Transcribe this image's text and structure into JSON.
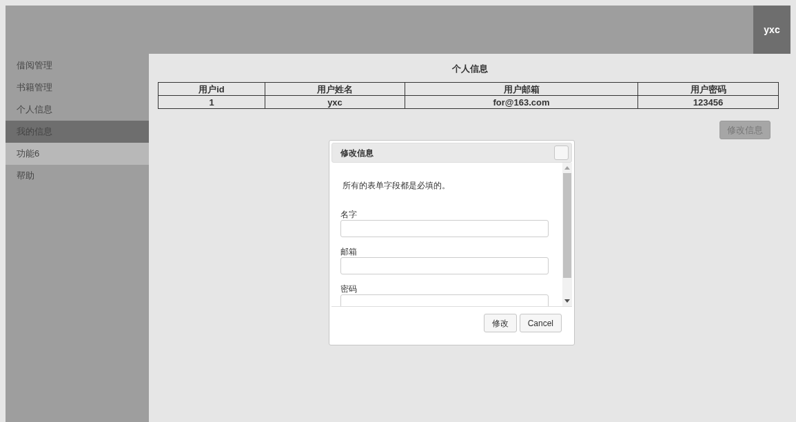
{
  "header": {
    "user": "yxc"
  },
  "sidebar": {
    "items": [
      {
        "label": "借阅管理",
        "selected": false,
        "hovered": false
      },
      {
        "label": "书籍管理",
        "selected": false,
        "hovered": false
      },
      {
        "label": "个人信息",
        "selected": false,
        "hovered": false
      },
      {
        "label": "我的信息",
        "selected": true,
        "hovered": false
      },
      {
        "label": "功能6",
        "selected": false,
        "hovered": true
      },
      {
        "label": "帮助",
        "selected": false,
        "hovered": false
      }
    ]
  },
  "content": {
    "title": "个人信息",
    "table": {
      "columns": [
        "用户id",
        "用户姓名",
        "用户邮箱",
        "用户密码"
      ],
      "rows": [
        [
          "1",
          "yxc",
          "for@163.com",
          "123456"
        ]
      ]
    },
    "edit_button": {
      "label": "修改信息",
      "disabled": true
    }
  },
  "dialog": {
    "title": "修改信息",
    "note": "所有的表单字段都是必填的。",
    "fields": [
      {
        "label": "名字"
      },
      {
        "label": "邮箱"
      },
      {
        "label": "密码"
      }
    ],
    "buttons": [
      "修改",
      "Cancel"
    ]
  }
}
